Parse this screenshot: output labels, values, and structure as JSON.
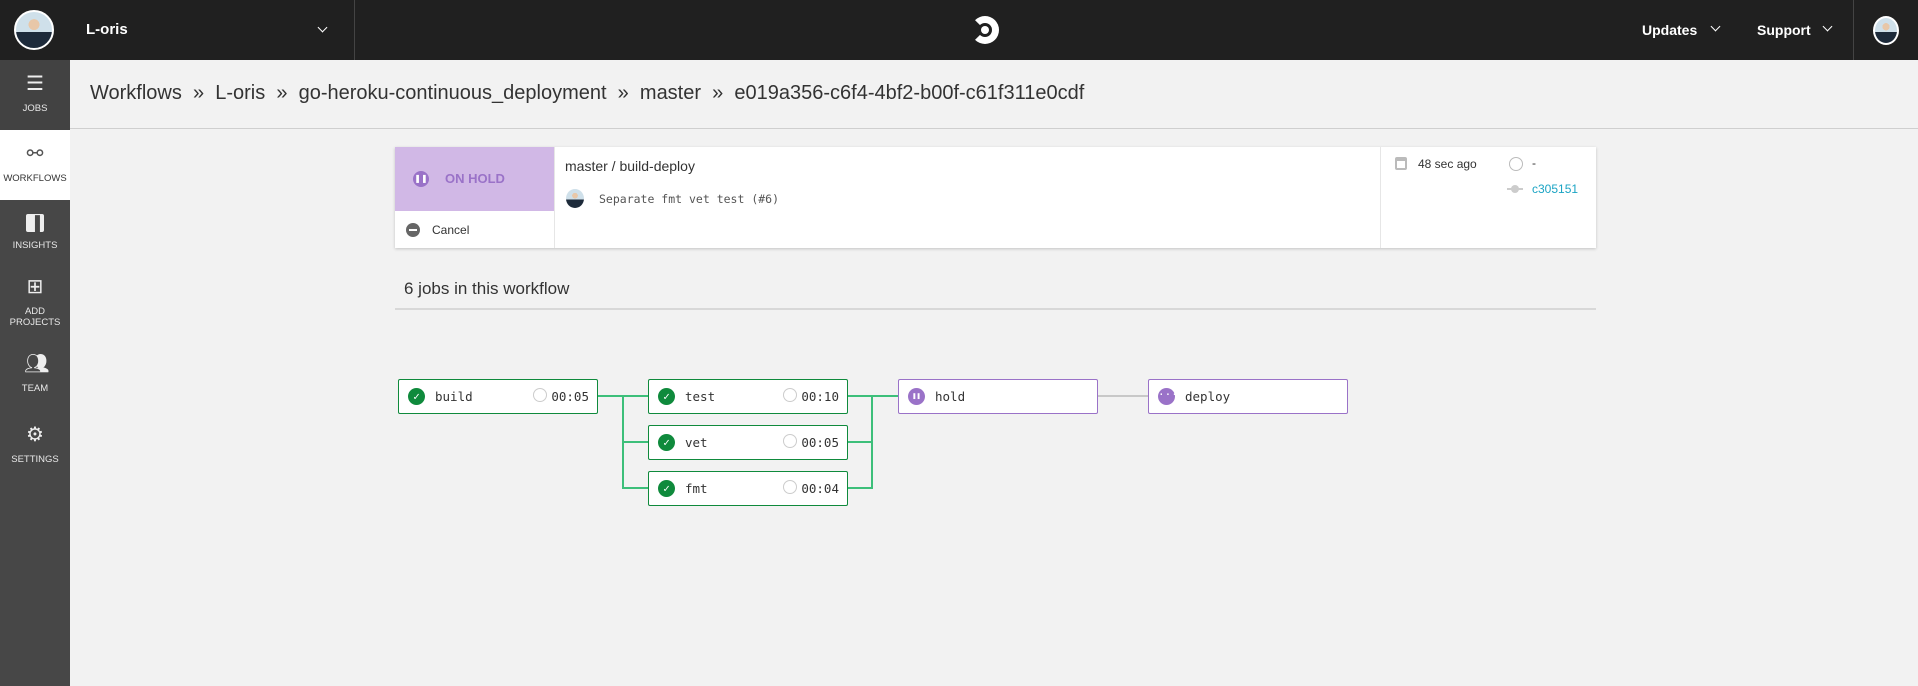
{
  "topbar": {
    "org": "L-oris",
    "nav": [
      {
        "label": "Updates"
      },
      {
        "label": "Support"
      }
    ]
  },
  "sidebar": {
    "items": [
      {
        "label": "JOBS",
        "icon": "list-icon"
      },
      {
        "label": "WORKFLOWS",
        "icon": "workflow-icon",
        "active": true
      },
      {
        "label": "INSIGHTS",
        "icon": "bar-chart-icon"
      },
      {
        "label": "ADD",
        "label2": "PROJECTS",
        "icon": "add-project-icon"
      },
      {
        "label": "TEAM",
        "icon": "team-icon"
      },
      {
        "label": "SETTINGS",
        "icon": "gears-icon"
      }
    ]
  },
  "breadcrumb": {
    "text": "Workflows  »  L-oris  »  go-heroku-continuous_deployment  »  master  »  e019a356-c6f4-4bf2-b00f-c61f311e0cdf"
  },
  "workflow": {
    "status": "ON HOLD",
    "cancel": "Cancel",
    "branch_workflow": "master / build-deploy",
    "commit_message": "Separate fmt vet test (#6)",
    "time_ago": "48 sec ago",
    "duration": "-",
    "commit_hash": "c305151"
  },
  "colors": {
    "success": "#0f8a3c",
    "hold": "#9a72c8",
    "status_bg": "#d1b8e6",
    "link": "#1ba4c4"
  },
  "jobs_heading": "6 jobs in this workflow",
  "jobs": [
    {
      "name": "build",
      "status": "success",
      "duration": "00:05"
    },
    {
      "name": "test",
      "status": "success",
      "duration": "00:10"
    },
    {
      "name": "vet",
      "status": "success",
      "duration": "00:05"
    },
    {
      "name": "fmt",
      "status": "success",
      "duration": "00:04"
    },
    {
      "name": "hold",
      "status": "on-hold"
    },
    {
      "name": "deploy",
      "status": "blocked"
    }
  ]
}
